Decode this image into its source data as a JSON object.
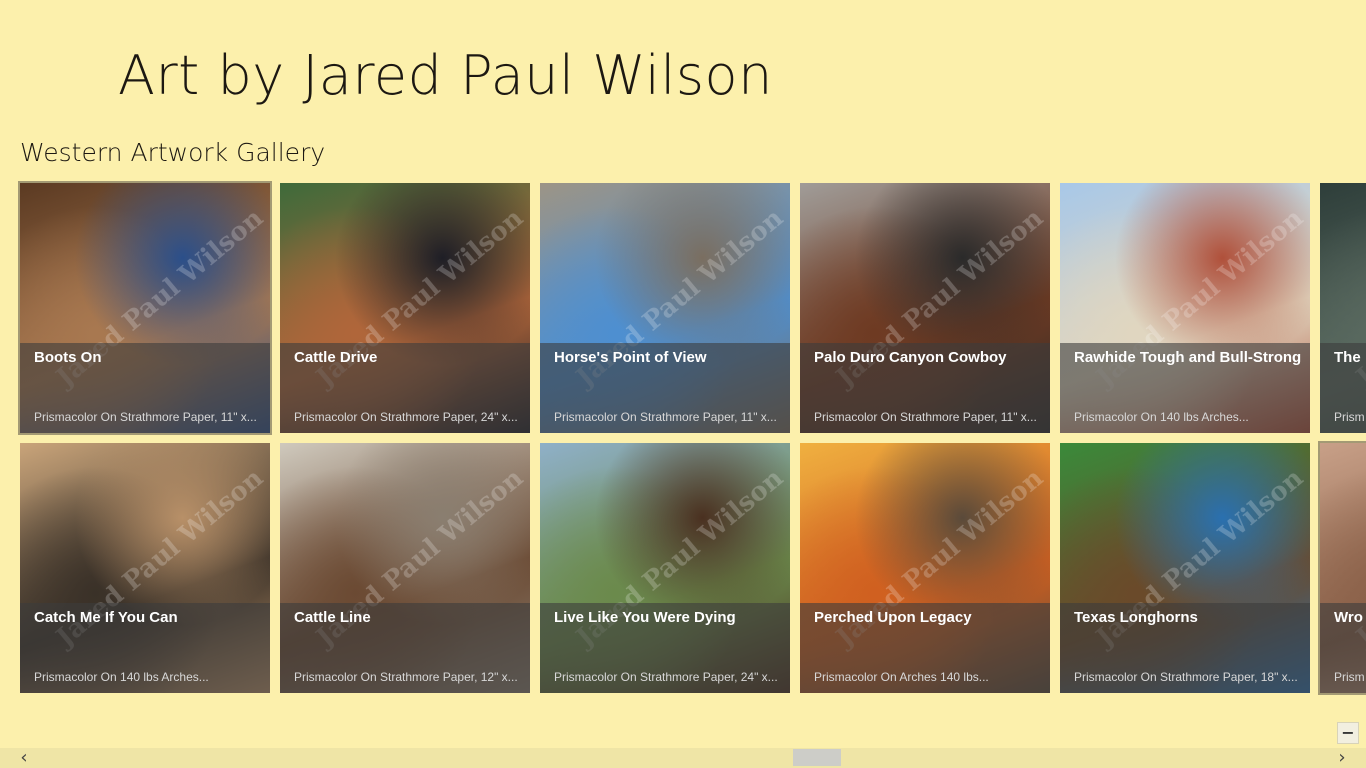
{
  "app": {
    "title": "Art by Jared Paul Wilson"
  },
  "gallery": {
    "section_title": "Western Artwork Gallery",
    "watermark": "Jared Paul Wilson",
    "items": [
      {
        "title": "Boots On",
        "subtitle": "Prismacolor On Strathmore Paper, 11\" x...",
        "colors": [
          "#5b3a22",
          "#a87850",
          "#2b4f8a"
        ]
      },
      {
        "title": "Catch Me If You Can",
        "subtitle": "Prismacolor On 140 lbs Arches...",
        "colors": [
          "#c9a47a",
          "#3a3128",
          "#b89068"
        ]
      },
      {
        "title": "Cattle Drive",
        "subtitle": "Prismacolor On Strathmore Paper, 24\" x...",
        "colors": [
          "#3e6a3a",
          "#b0663a",
          "#1e1e26"
        ]
      },
      {
        "title": "Cattle Line",
        "subtitle": "Prismacolor On Strathmore Paper, 12\" x...",
        "colors": [
          "#cfc9bd",
          "#6b4a33",
          "#8a7e70"
        ]
      },
      {
        "title": "Horse's Point of View",
        "subtitle": "Prismacolor On Strathmore Paper, 11\" x...",
        "colors": [
          "#9c9486",
          "#4e8fd0",
          "#7a6e60"
        ]
      },
      {
        "title": "Live Like You Were Dying",
        "subtitle": "Prismacolor On Strathmore Paper, 24\" x...",
        "colors": [
          "#8fb0c8",
          "#6b8a4c",
          "#4a3020"
        ]
      },
      {
        "title": "Palo Duro Canyon Cowboy",
        "subtitle": "Prismacolor On Strathmore Paper, 11\" x...",
        "colors": [
          "#a09c98",
          "#6e3a22",
          "#2a2a2a"
        ]
      },
      {
        "title": "Perched Upon Legacy",
        "subtitle": "Prismacolor On Arches 140 lbs...",
        "colors": [
          "#f0b040",
          "#d06020",
          "#5a4a3a"
        ]
      },
      {
        "title": "Rawhide Tough and Bull-Strong",
        "subtitle": "Prismacolor On 140 lbs Arches...",
        "colors": [
          "#a8c8e8",
          "#e0d6c0",
          "#b0503a"
        ]
      },
      {
        "title": "Texas Longhorns",
        "subtitle": "Prismacolor On Strathmore Paper, 18\" x...",
        "colors": [
          "#3a8a3a",
          "#6a4a2a",
          "#2a70b0"
        ]
      },
      {
        "title": "The",
        "subtitle": "Prism",
        "colors": [
          "#2e3e3a",
          "#5a6a60",
          "#3a4a44"
        ]
      },
      {
        "title": "Wro",
        "subtitle": "Prism",
        "colors": [
          "#c8a088",
          "#8a6048",
          "#e0c0a8"
        ]
      }
    ]
  },
  "scrollbar": {
    "left_arrow": "‹",
    "right_arrow": "›",
    "position": 0.6
  },
  "zoom": {
    "label": "−"
  }
}
